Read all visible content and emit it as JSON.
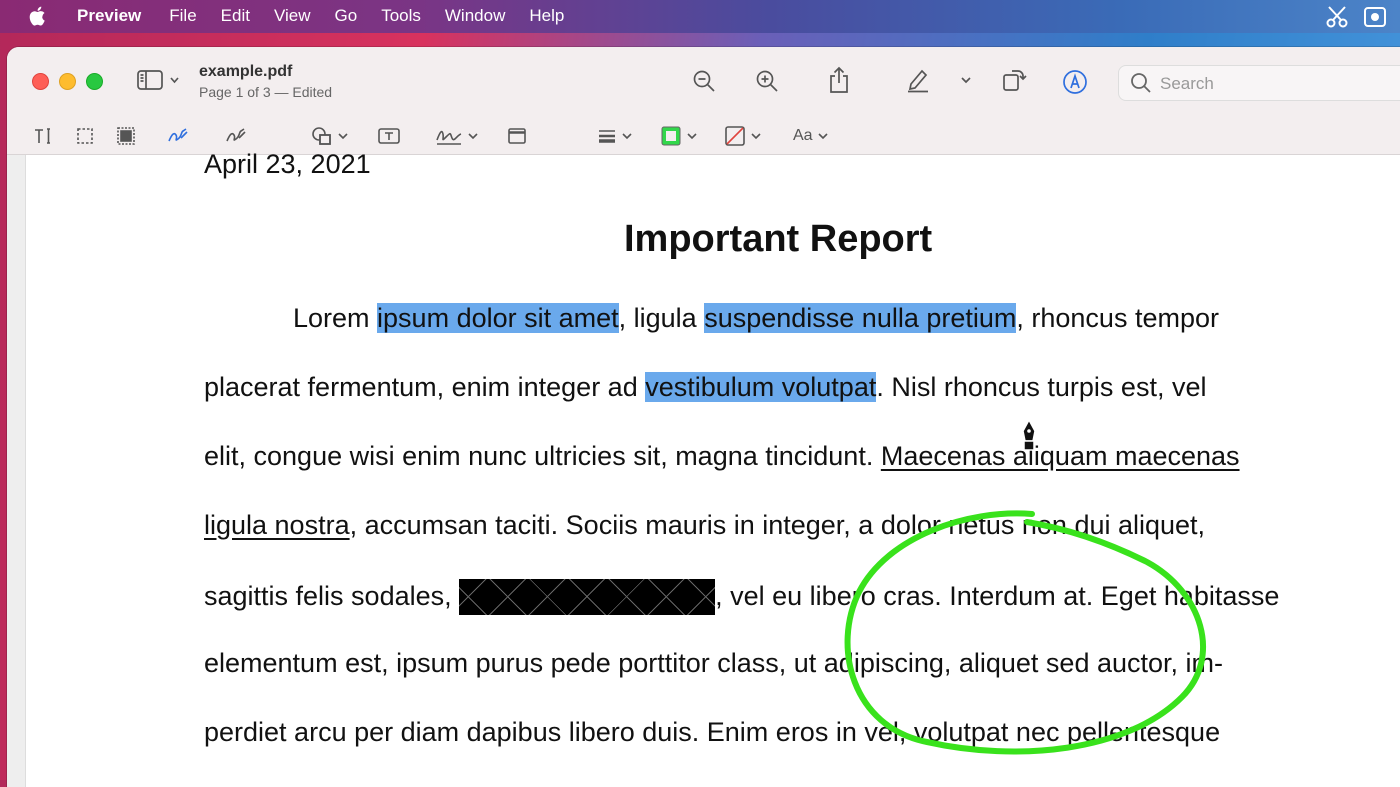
{
  "menubar": {
    "app_name": "Preview",
    "items": [
      "File",
      "Edit",
      "View",
      "Go",
      "Tools",
      "Window",
      "Help"
    ],
    "icons": [
      "apple-logo-icon",
      "scissors-icon",
      "screen-record-icon"
    ]
  },
  "window": {
    "title": "example.pdf",
    "subtitle": "Page 1 of 3 — Edited",
    "search_placeholder": "Search",
    "toolbar_icons": [
      "sidebar-icon",
      "zoom-out-icon",
      "zoom-in-icon",
      "share-icon",
      "highlight-pen-icon",
      "rotate-icon",
      "markup-icon",
      "search-icon"
    ],
    "markup_icons": [
      "text-selection-icon",
      "rect-selection-icon",
      "smart-lasso-icon",
      "sketch-icon",
      "draw-icon",
      "shapes-icon",
      "text-box-icon",
      "sign-icon",
      "note-icon",
      "shape-style-icon",
      "border-color-icon",
      "fill-color-icon"
    ],
    "text_style_label": "Aa",
    "border_color": "#32d74b",
    "highlight_color": "#6aa9ec",
    "annotation_color": "#39e21c"
  },
  "document": {
    "date": "April 23, 2021",
    "title": "Important Report",
    "lines": [
      {
        "parts": [
          {
            "text": "Lorem ",
            "style": "plain"
          },
          {
            "text": "ipsum dolor sit amet",
            "style": "highlight"
          },
          {
            "text": ", ligula ",
            "style": "plain"
          },
          {
            "text": "suspendisse nulla pretium",
            "style": "highlight"
          },
          {
            "text": ", rhoncus tempor",
            "style": "plain"
          }
        ]
      },
      {
        "parts": [
          {
            "text": "placerat fermentum, enim integer ad ",
            "style": "plain"
          },
          {
            "text": "vestibulum volutpat",
            "style": "highlight"
          },
          {
            "text": ". Nisl rhoncus turpis est, vel",
            "style": "plain"
          }
        ]
      },
      {
        "parts": [
          {
            "text": "elit, congue wisi enim nunc ultricies sit, magna tincidunt. ",
            "style": "plain"
          },
          {
            "text": "Maecenas aliquam maecenas",
            "style": "underline"
          }
        ]
      },
      {
        "parts": [
          {
            "text": "ligula nostra",
            "style": "underline"
          },
          {
            "text": ", accumsan taciti. Sociis mauris in integer, a dolor netus non dui aliquet,",
            "style": "plain"
          }
        ]
      },
      {
        "parts": [
          {
            "text": "sagittis felis sodales, ",
            "style": "plain"
          },
          {
            "text": "",
            "style": "redacted"
          },
          {
            "text": ", vel eu libero cras. Interdum at. Eget habitasse",
            "style": "plain"
          }
        ]
      },
      {
        "parts": [
          {
            "text": "elementum est, ipsum purus pede porttitor class, ut adipiscing, aliquet sed auctor, im-",
            "style": "plain"
          }
        ]
      },
      {
        "parts": [
          {
            "text": "perdiet arcu per diam dapibus libero duis. Enim eros in vel, volutpat nec pellentesque",
            "style": "plain"
          }
        ]
      }
    ]
  }
}
